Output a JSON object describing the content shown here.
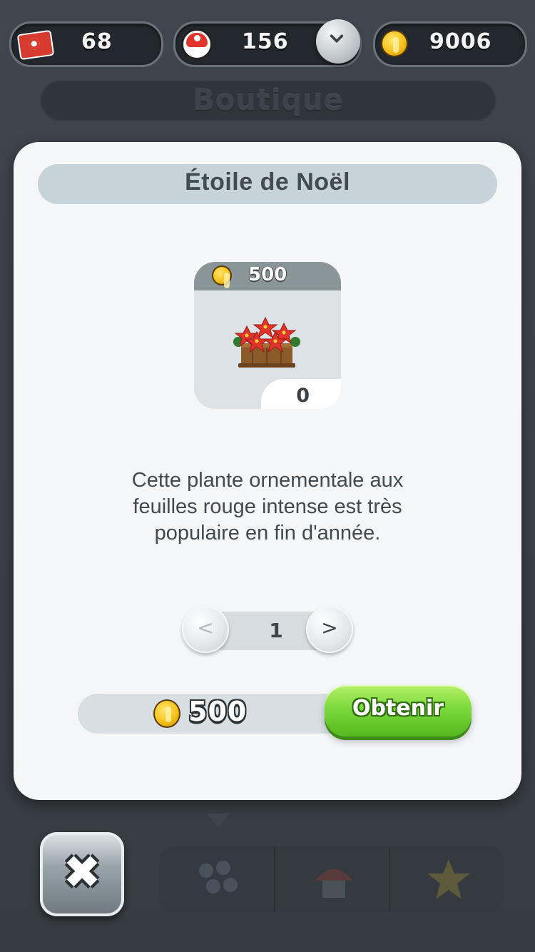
{
  "header": {
    "tickets": "68",
    "toads": "156",
    "coins": "9006"
  },
  "background": {
    "title": "Boutique"
  },
  "modal": {
    "title": "Étoile de Noël",
    "item": {
      "price": "500",
      "owned": "0"
    },
    "description": [
      "Cette plante ornementale aux",
      "feuilles rouge intense est très",
      "populaire en fin d'année."
    ],
    "quantity": "1",
    "quantity_dec": "<",
    "quantity_inc": ">",
    "total_price": "500",
    "buy_label": "Obtenir"
  },
  "close_glyph": "✖",
  "icons": {
    "tickets": "ticket-icon",
    "toads": "toad-icon",
    "coins": "coin-icon",
    "dropdown": "chevron-down-icon",
    "tabs": [
      "flowers-icon",
      "toad-house-icon",
      "star-icon"
    ]
  },
  "colors": {
    "buy_button": "#7cd93d",
    "header_pill": "#c6d3d8",
    "coin": "#f6c21b",
    "flower_red": "#e0342a"
  }
}
